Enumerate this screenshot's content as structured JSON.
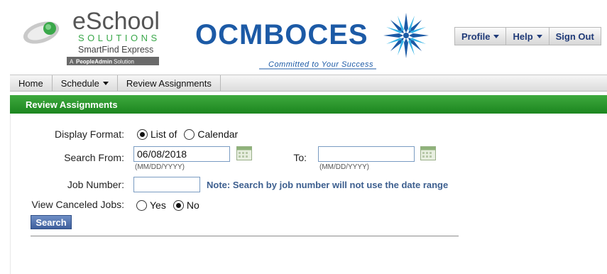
{
  "logos": {
    "eschool_main": "eSchool",
    "eschool_sub": "SOLUTIONS",
    "smartfind": "SmartFind Express",
    "peopleadmin_prefix": "A",
    "peopleadmin_brand": "PeopleAdmin",
    "peopleadmin_suffix": "Solution",
    "ocm_name": "OCMBOCES",
    "ocm_tagline": "Committed to Your Success"
  },
  "user_nav": {
    "profile": "Profile",
    "help": "Help",
    "sign_out": "Sign Out"
  },
  "main_nav": {
    "home": "Home",
    "schedule": "Schedule",
    "review": "Review Assignments"
  },
  "section": {
    "title": "Review Assignments"
  },
  "form": {
    "display_format_label": "Display Format:",
    "display_list": "List of",
    "display_calendar": "Calendar",
    "display_selected": "List of",
    "search_from_label": "Search From:",
    "search_from_value": "06/08/2018",
    "date_hint": "(MM/DD/YYYY)",
    "to_label": "To:",
    "to_value": "",
    "to_hint": "(MM/DD/YYYY)",
    "job_number_label": "Job Number:",
    "job_number_value": "",
    "job_note": "Note: Search by job number will not use the date range",
    "canceled_label": "View Canceled Jobs:",
    "canceled_yes": "Yes",
    "canceled_no": "No",
    "canceled_selected": "No",
    "search_button": "Search"
  },
  "colors": {
    "section_green": "#2a9a2c",
    "nav_text_blue": "#1f3a78",
    "note_blue": "#3d5f8f",
    "ocm_blue": "#1c5aa6",
    "eschool_green": "#2f9e4a"
  }
}
